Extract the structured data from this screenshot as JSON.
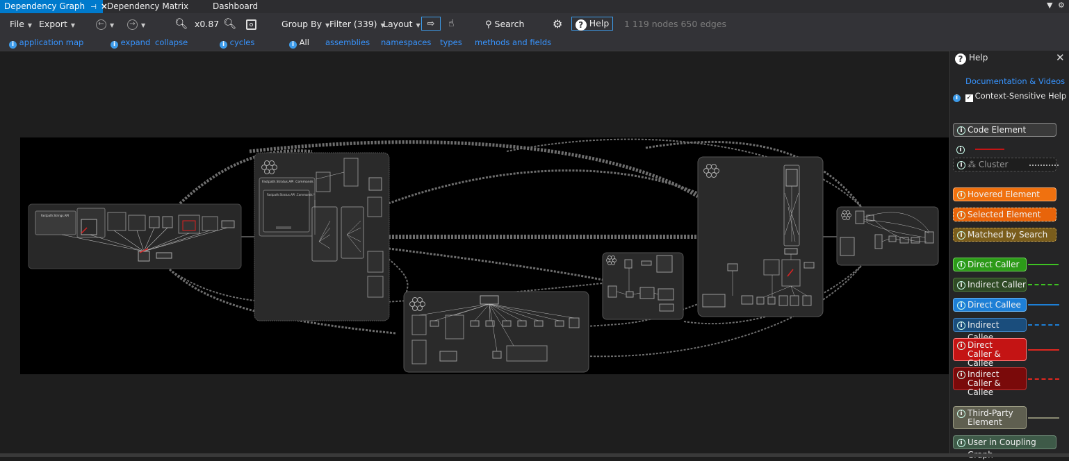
{
  "tabs": [
    {
      "label": "Dependency Graph",
      "active": true
    },
    {
      "label": "Dependency Matrix",
      "active": false
    },
    {
      "label": "Dashboard",
      "active": false
    }
  ],
  "toolbar": {
    "file": "File",
    "export": "Export",
    "zoom": "x0.87",
    "group_by": "Group By",
    "filter": "Filter (339)",
    "layout": "Layout",
    "search": "Search",
    "help": "Help",
    "stats": "1 119 nodes 650 edges"
  },
  "links": {
    "application_map": "application map",
    "expand": "expand",
    "collapse": "collapse",
    "cycles": "cycles",
    "all": "All",
    "assemblies": "assemblies",
    "namespaces": "namespaces",
    "types": "types",
    "methods_and_fields": "methods and fields"
  },
  "graph": {
    "cluster_a_title": "Fastpath.Strings.API",
    "cluster_b_title": "Fastpath.Stratus.API .Commands",
    "cluster_b_sub": "Fastpath.Stratus.API .Commands.*"
  },
  "help_panel": {
    "title": "Help",
    "docs_link": "Documentation & Videos",
    "context_help": "Context-Sensitive Help",
    "context_help_checked": true,
    "legend": [
      {
        "label": "Code Element"
      },
      {
        "label": "Cluster"
      },
      {
        "label": "Hovered Element"
      },
      {
        "label": "Selected Element"
      },
      {
        "label": "Matched by Search"
      },
      {
        "label": "Direct Caller"
      },
      {
        "label": "Indirect Caller"
      },
      {
        "label": "Direct Callee"
      },
      {
        "label": "Indirect Callee"
      },
      {
        "label": "Direct\nCaller & Callee"
      },
      {
        "label": "Indirect\nCaller & Callee"
      },
      {
        "label": "Third-Party\nElement"
      },
      {
        "label": "User in Coupling Graph"
      }
    ],
    "colors": {
      "hovered": "#f0710f",
      "selected": "#e8640a",
      "matched": "#7a5d1c",
      "direct_caller": "#2c9a18",
      "indirect_caller": "#3a6a24",
      "direct_callee": "#1d7fd6",
      "indirect_callee": "#1f5f9a",
      "direct_both": "#c41414",
      "indirect_both": "#7a0a0a",
      "third_party": "#5f5f50",
      "coupling": "#3e5a48"
    }
  }
}
